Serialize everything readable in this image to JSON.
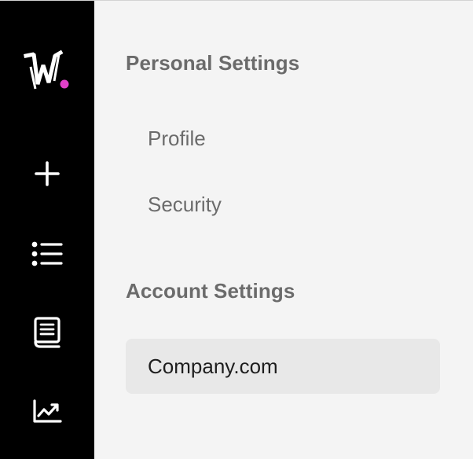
{
  "rail": {
    "background": "#000000",
    "logo": {
      "icon": "brand-w-logo",
      "dot_color": "#e040c8"
    },
    "buttons": [
      {
        "name": "add-button",
        "icon": "plus-icon"
      },
      {
        "name": "list-button",
        "icon": "list-icon"
      },
      {
        "name": "docs-button",
        "icon": "book-icon"
      },
      {
        "name": "analytics-button",
        "icon": "chart-icon"
      }
    ]
  },
  "settings": {
    "personal_heading": "Personal Settings",
    "personal_items": [
      {
        "label": "Profile"
      },
      {
        "label": "Security"
      }
    ],
    "account_heading": "Account Settings",
    "account_items": [
      {
        "label": "Company.com",
        "selected": true
      }
    ]
  },
  "colors": {
    "panel_bg": "#f4f4f4",
    "selected_bg": "#e8e8e8",
    "muted_text": "#6b6b6b",
    "active_text": "#1e1e1e"
  }
}
